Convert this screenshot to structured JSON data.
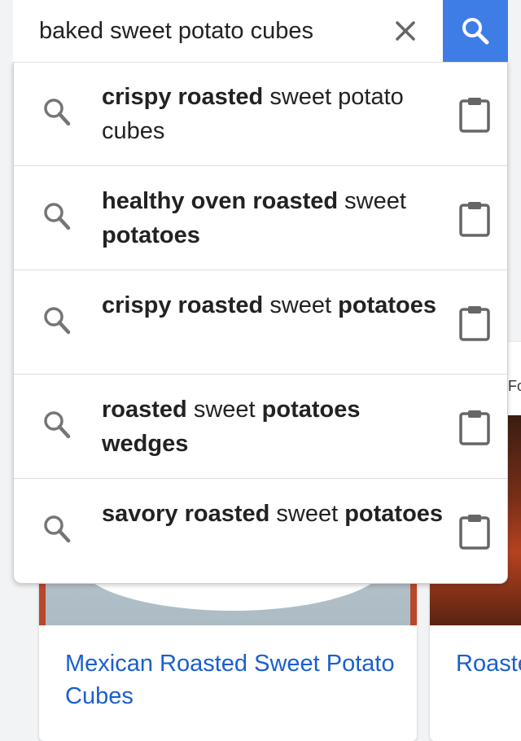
{
  "search": {
    "query": "baked sweet potato cubes",
    "clear_icon": "close-icon",
    "submit_icon": "search-icon",
    "accent_color": "#3f7de6"
  },
  "suggestions": [
    {
      "parts": [
        {
          "text": "crispy roasted",
          "bold": true
        },
        {
          "text": " sweet potato cubes",
          "bold": false
        }
      ]
    },
    {
      "parts": [
        {
          "text": "healthy oven roasted",
          "bold": true
        },
        {
          "text": " sweet ",
          "bold": false
        },
        {
          "text": "potatoes",
          "bold": true
        }
      ]
    },
    {
      "parts": [
        {
          "text": "crispy roasted",
          "bold": true
        },
        {
          "text": " sweet ",
          "bold": false
        },
        {
          "text": "potatoes",
          "bold": true
        }
      ]
    },
    {
      "parts": [
        {
          "text": "roasted",
          "bold": true
        },
        {
          "text": " sweet ",
          "bold": false
        },
        {
          "text": "potatoes wedges",
          "bold": true
        }
      ]
    },
    {
      "parts": [
        {
          "text": "savory roasted",
          "bold": true
        },
        {
          "text": " sweet ",
          "bold": false
        },
        {
          "text": "potatoes",
          "bold": true
        }
      ]
    }
  ],
  "results": [
    {
      "title": "Mexican Roasted Sweet Potato Cubes"
    },
    {
      "title": "Roasted Sweet Potatoes with H",
      "label": "Fo"
    }
  ],
  "link_color": "#1a5fcf"
}
